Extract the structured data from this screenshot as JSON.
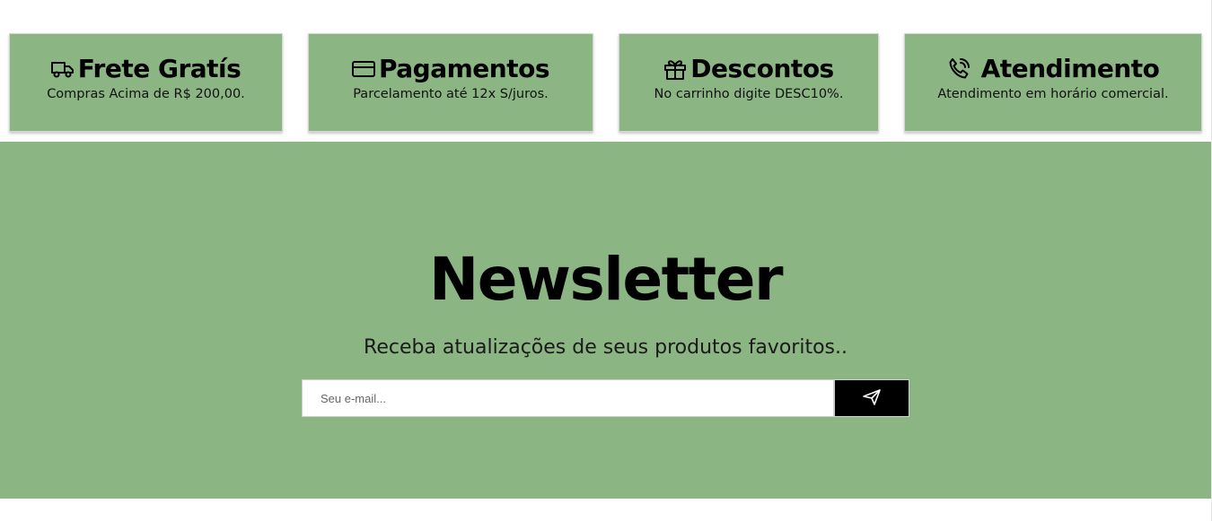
{
  "features": [
    {
      "icon": "truck-icon",
      "title": "Frete Gratís",
      "description": "Compras Acima de R$ 200,00."
    },
    {
      "icon": "credit-card-icon",
      "title": "Pagamentos",
      "description": "Parcelamento até 12x S/juros."
    },
    {
      "icon": "gift-icon",
      "title": "Descontos",
      "description": "No carrinho digite DESC10%."
    },
    {
      "icon": "phone-call-icon",
      "title": "Atendimento",
      "description": "Atendimento em horário comercial."
    }
  ],
  "newsletter": {
    "title": "Newsletter",
    "subtitle": "Receba atualizações de seus produtos favoritos..",
    "email_placeholder": "Seu e-mail...",
    "email_value": "",
    "submit_icon": "send-icon"
  },
  "colors": {
    "accent_green": "#8bb583",
    "button_black": "#000000",
    "background": "#ffffff"
  }
}
